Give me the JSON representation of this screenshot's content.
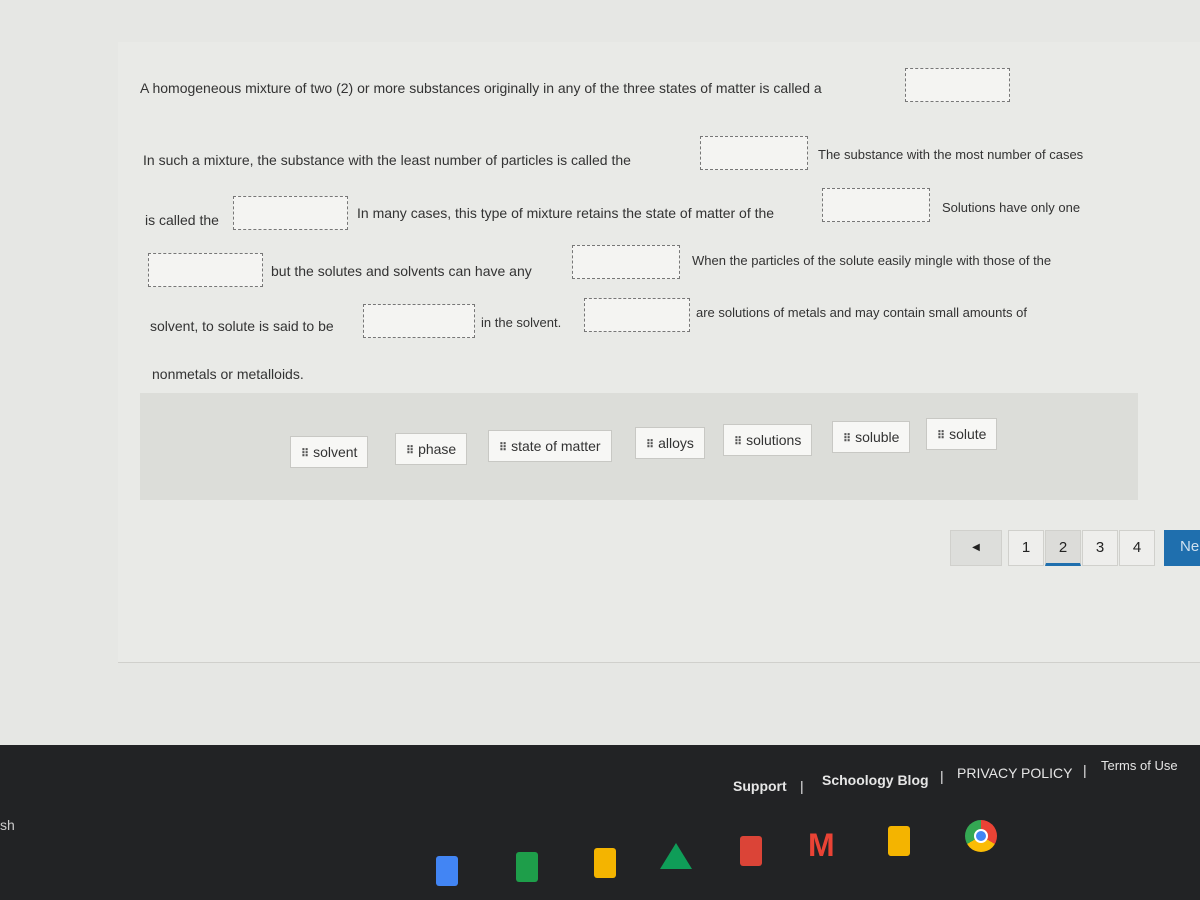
{
  "question": {
    "segments": [
      "A homogeneous mixture of two (2) or more substances originally in any of the three states of matter is called a",
      "In such a mixture, the substance with the least number of particles is called the",
      "The substance with the most number of cases",
      "is called the",
      "In many cases, this type of mixture retains the state of matter of the",
      "Solutions have only one",
      "but the solutes and solvents can have any",
      "When the particles of the solute easily mingle with those of the",
      "solvent, to solute is said to be",
      "in the solvent.",
      "are solutions of metals and may contain small amounts of",
      "nonmetals or metalloids."
    ]
  },
  "word_bank": [
    "solvent",
    "phase",
    "state of matter",
    "alloys",
    "solutions",
    "soluble",
    "solute"
  ],
  "pagination": {
    "prev_icon": "triangle-left-icon",
    "pages": [
      "1",
      "2",
      "3",
      "4"
    ],
    "current": "2",
    "next_label": "Ne",
    "accent": "#1f6fae"
  },
  "footer": {
    "links": [
      "Support",
      "Schoology Blog",
      "PRIVACY POLICY",
      "Terms of Use"
    ],
    "separator": "|"
  },
  "shelf": {
    "left_text": "sh",
    "apps": [
      "docs-icon",
      "sheets-icon",
      "slides-icon",
      "drive-icon",
      "slides-red-icon",
      "gmail-icon",
      "keep-icon",
      "chrome-icon"
    ]
  }
}
